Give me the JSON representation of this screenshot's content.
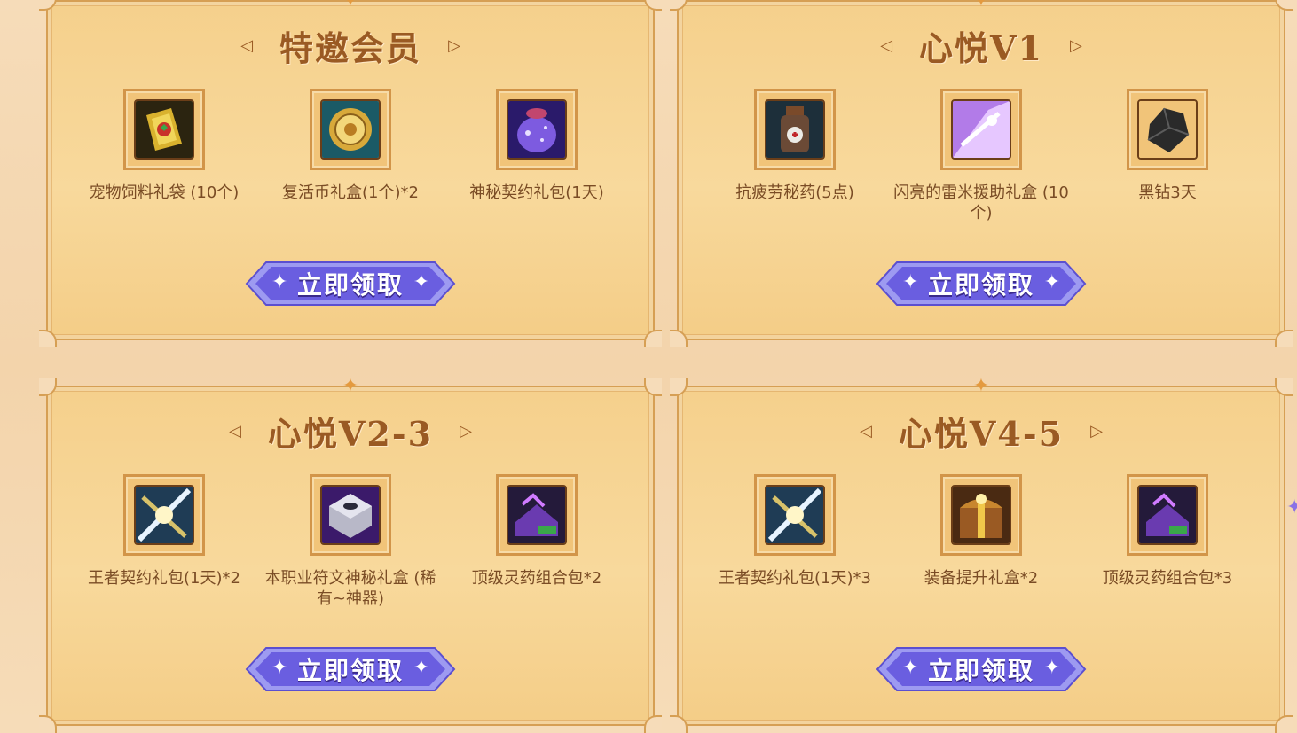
{
  "panels": [
    {
      "title": "特邀会员",
      "items": [
        {
          "label": "宠物饲料礼袋 (10个)",
          "icon": "pet-food-bag-icon"
        },
        {
          "label": "复活币礼盒(1个)*2",
          "icon": "revive-coin-icon"
        },
        {
          "label": "神秘契约礼包(1天)",
          "icon": "mystery-contract-pack-icon"
        }
      ],
      "button_label": "立即领取"
    },
    {
      "title": "心悦V1",
      "items": [
        {
          "label": "抗疲劳秘药(5点)",
          "icon": "fatigue-potion-icon"
        },
        {
          "label": "闪亮的雷米援助礼盒 (10个)",
          "icon": "shiny-remy-box-icon"
        },
        {
          "label": "黑钻3天",
          "icon": "black-diamond-icon"
        }
      ],
      "button_label": "立即领取"
    },
    {
      "title": "心悦V2-3",
      "items": [
        {
          "label": "王者契约礼包(1天)*2",
          "icon": "king-contract-pack-icon"
        },
        {
          "label": "本职业符文神秘礼盒 (稀有~神器)",
          "icon": "rune-mystery-box-icon"
        },
        {
          "label": "顶级灵药组合包*2",
          "icon": "elixir-combo-pack-icon"
        }
      ],
      "button_label": "立即领取"
    },
    {
      "title": "心悦V4-5",
      "items": [
        {
          "label": "王者契约礼包(1天)*3",
          "icon": "king-contract-pack-icon"
        },
        {
          "label": "装备提升礼盒*2",
          "icon": "equipment-upgrade-box-icon"
        },
        {
          "label": "顶级灵药组合包*3",
          "icon": "elixir-combo-pack-icon"
        }
      ],
      "button_label": "立即领取"
    }
  ],
  "colors": {
    "background": "#f6dcb9",
    "panel": "#f8d99c",
    "panel_border": "#d69f54",
    "title": "#9a5a23",
    "button": "#6a5ee0",
    "item_text": "#7a4c25"
  }
}
